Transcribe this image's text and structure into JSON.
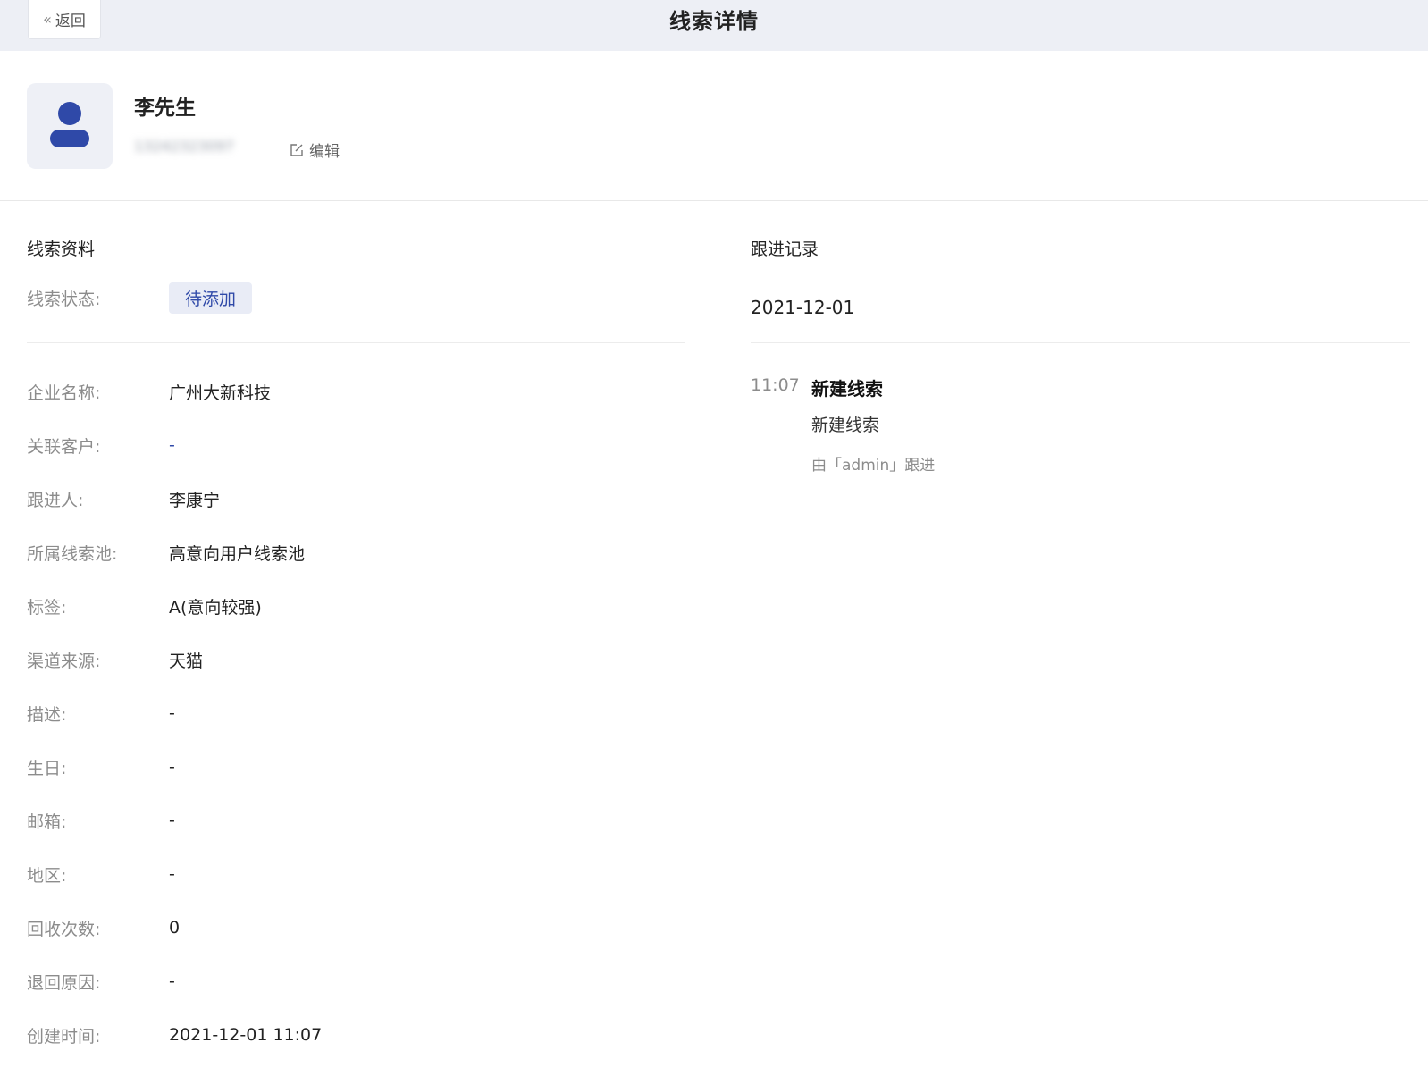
{
  "header": {
    "back_label": "返回",
    "title": "线索详情"
  },
  "profile": {
    "name": "李先生",
    "phone": "13242323097",
    "edit_label": "编辑"
  },
  "lead_info": {
    "section_title": "线索资料",
    "status_label": "线索状态:",
    "status_value": "待添加",
    "fields": [
      {
        "label": "企业名称:",
        "value": "广州大新科技"
      },
      {
        "label": "关联客户:",
        "value": "-"
      },
      {
        "label": "跟进人:",
        "value": "李康宁"
      },
      {
        "label": "所属线索池:",
        "value": "高意向用户线索池"
      },
      {
        "label": "标签:",
        "value": "A(意向较强)"
      },
      {
        "label": "渠道来源:",
        "value": "天猫"
      },
      {
        "label": "描述:",
        "value": "-"
      },
      {
        "label": "生日:",
        "value": "-"
      },
      {
        "label": "邮箱:",
        "value": "-"
      },
      {
        "label": "地区:",
        "value": "-"
      },
      {
        "label": "回收次数:",
        "value": "0"
      },
      {
        "label": "退回原因:",
        "value": "-"
      },
      {
        "label": "创建时间:",
        "value": "2021-12-01 11:07"
      }
    ]
  },
  "follow_up": {
    "section_title": "跟进记录",
    "date": "2021-12-01",
    "records": [
      {
        "time": "11:07",
        "title": "新建线索",
        "desc": "新建线索",
        "by": "由「admin」跟进"
      }
    ]
  },
  "colors": {
    "accent": "#2f49a8",
    "topbar_bg": "#edeff5",
    "tag_bg": "#e9ecf6"
  }
}
